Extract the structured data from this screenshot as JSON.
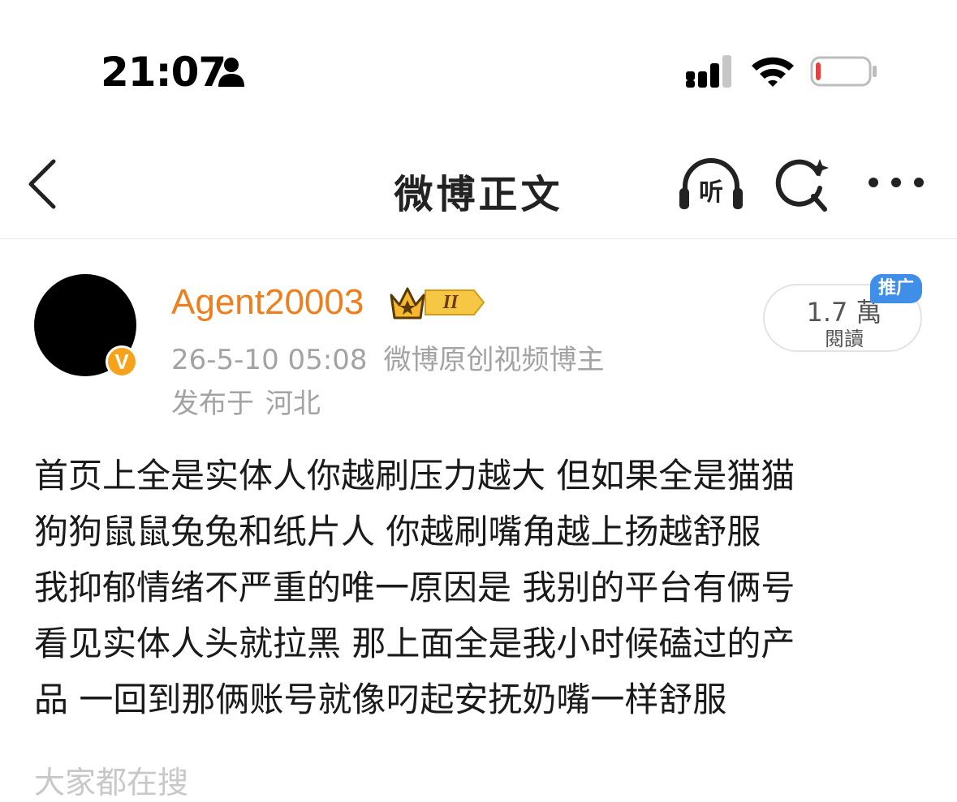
{
  "status_bar": {
    "time": "21:07",
    "icons": [
      "person-icon",
      "signal-icon",
      "wifi-icon",
      "battery-icon"
    ],
    "battery_color": "#f23c3c",
    "battery_level": 0.08
  },
  "nav": {
    "title": "微博正文",
    "listen_label": "听",
    "icons": [
      "back-icon",
      "listen-icon",
      "search-icon",
      "more-icon"
    ]
  },
  "post": {
    "author": "Agent20003",
    "author_color": "#ee7e1e",
    "verified_mark": "V",
    "crown_level": "II",
    "timestamp": "26-5-10 05:08",
    "author_tag": "微博原创视频博主",
    "location_prefix": "发布于",
    "location": "河北",
    "read_count": "1.7 萬",
    "read_label": "閱讀",
    "promo_tag": "推广",
    "lines": [
      "首页上全是实体人你越刷压力越大 但如果全是猫猫",
      "狗狗鼠鼠兔兔和纸片人 你越刷嘴角越上扬越舒服",
      "我抑郁情绪不严重的唯一原因是 我别的平台有俩号",
      "看见实体人头就拉黑 那上面全是我小时候磕过的产",
      "品 一回到那俩账号就像叼起安抚奶嘴一样舒服"
    ],
    "cut_text": "大家都在搜"
  }
}
